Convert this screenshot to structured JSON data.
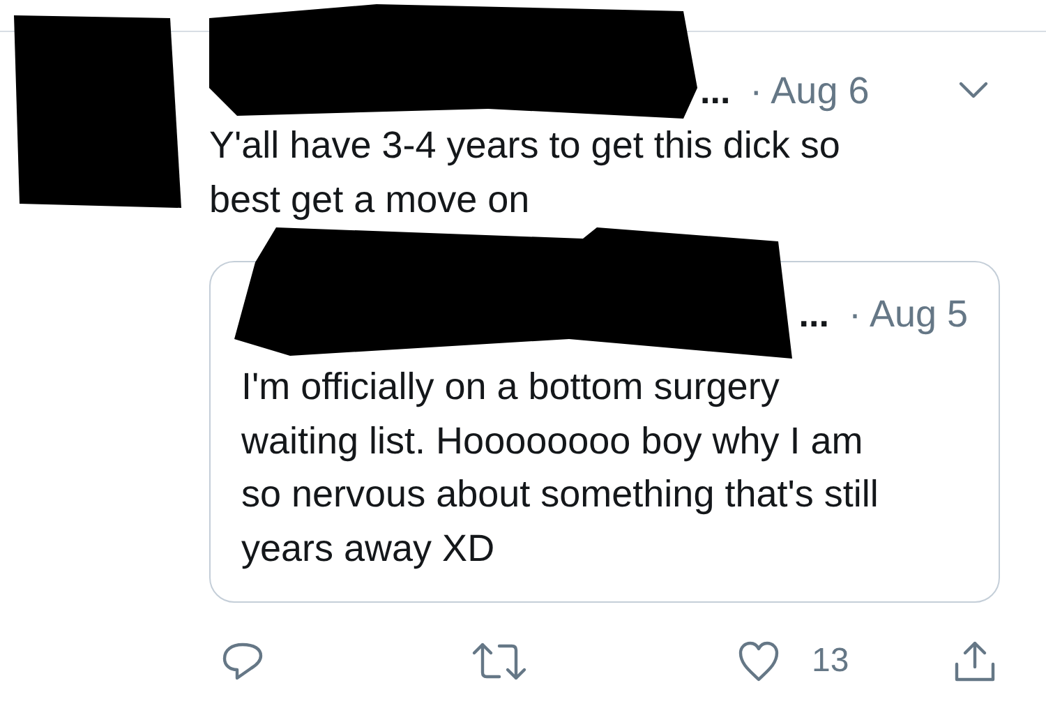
{
  "tweet": {
    "author_visible": "...",
    "date": "· Aug 6",
    "text": "Y'all have 3-4 years to get this dick so best get a move on"
  },
  "quoted_tweet": {
    "author_visible": "...",
    "date": "· Aug 5",
    "text": "I'm officially on a bottom surgery waiting list. Hoooooooo boy why I am so nervous about something that's still years away XD"
  },
  "actions": {
    "like_count": "13"
  }
}
